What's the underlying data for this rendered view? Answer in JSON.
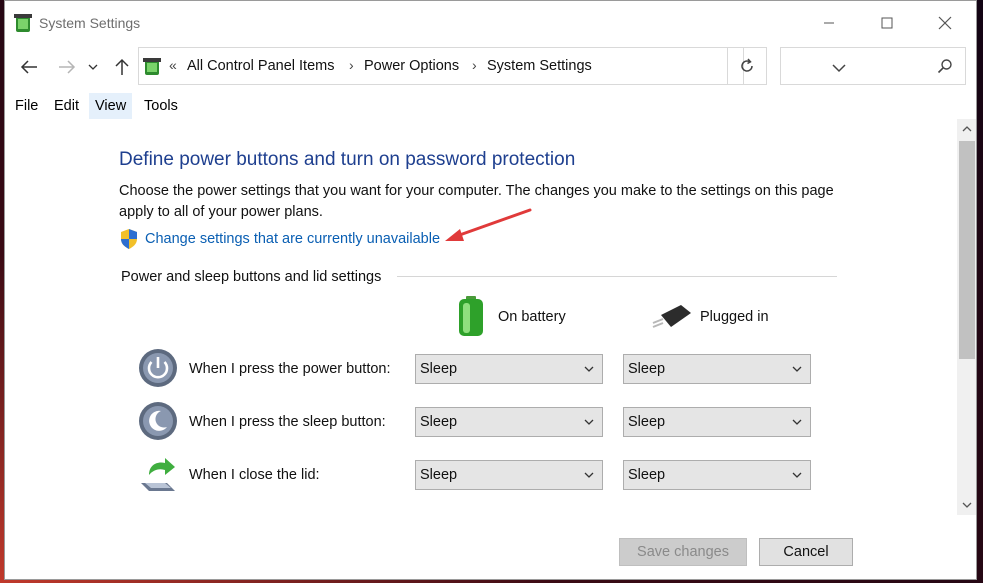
{
  "window": {
    "title": "System Settings"
  },
  "address": {
    "prefix": "«",
    "crumbs": [
      "All Control Panel Items",
      "Power Options",
      "System Settings"
    ],
    "separator": "›",
    "search_placeholder": ""
  },
  "menu": [
    "File",
    "Edit",
    "View",
    "Tools"
  ],
  "page": {
    "heading": "Define power buttons and turn on password protection",
    "description": "Choose the power settings that you want for your computer. The changes you make to the settings on this page apply to all of your power plans.",
    "link": "Change settings that are currently unavailable",
    "group_label": "Power and sleep buttons and lid settings",
    "columns": {
      "battery": "On battery",
      "plugged": "Plugged in"
    },
    "rows": [
      {
        "label": "When I press the power button:",
        "battery": "Sleep",
        "plugged": "Sleep"
      },
      {
        "label": "When I press the sleep button:",
        "battery": "Sleep",
        "plugged": "Sleep"
      },
      {
        "label": "When I close the lid:",
        "battery": "Sleep",
        "plugged": "Sleep"
      }
    ]
  },
  "buttons": {
    "save": "Save changes",
    "cancel": "Cancel"
  },
  "colors": {
    "heading": "#1e3f8f",
    "link": "#0a5fb3",
    "arrow": "#e03a3a"
  }
}
